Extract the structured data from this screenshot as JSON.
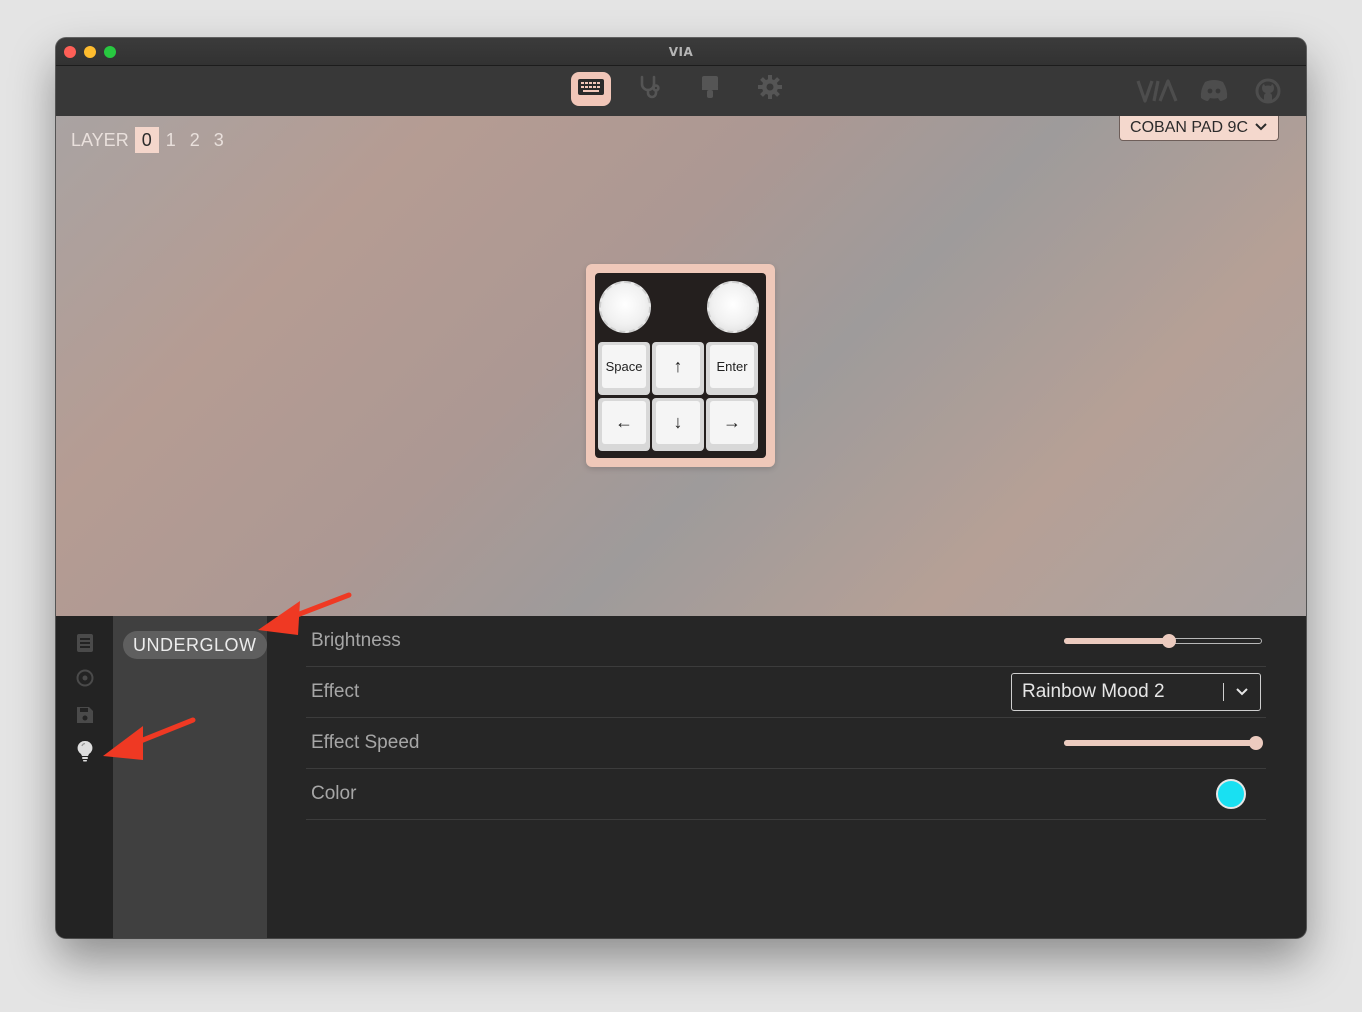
{
  "window": {
    "title": "VIA"
  },
  "toolbar": {
    "items": [
      {
        "name": "configure",
        "icon": "keyboard-icon",
        "active": true
      },
      {
        "name": "test",
        "icon": "stethoscope-icon",
        "active": false
      },
      {
        "name": "design",
        "icon": "paintbrush-icon",
        "active": false
      },
      {
        "name": "settings",
        "icon": "gear-icon",
        "active": false
      }
    ],
    "right_items": [
      "via-logo",
      "discord-icon",
      "github-icon"
    ]
  },
  "layers": {
    "label": "LAYER",
    "items": [
      "0",
      "1",
      "2",
      "3"
    ],
    "active_index": 0
  },
  "device": {
    "name": "COBAN PAD 9C"
  },
  "keyboard": {
    "knobs": 2,
    "keys": [
      "Space",
      "↑",
      "Enter",
      "←",
      "↓",
      "→"
    ]
  },
  "sidebar": {
    "icons": [
      "keymap-icon",
      "macro-icon",
      "save-icon",
      "lightbulb-icon"
    ],
    "active_icon": "lightbulb-icon"
  },
  "submenu": {
    "selected": "UNDERGLOW"
  },
  "settings": {
    "brightness": {
      "label": "Brightness",
      "level": 0.53
    },
    "effect": {
      "label": "Effect",
      "value": "Rainbow Mood 2"
    },
    "effect_speed": {
      "label": "Effect Speed",
      "level": 0.97
    },
    "color": {
      "label": "Color",
      "value": "#19e0f2"
    }
  },
  "colors": {
    "accent": "#f1c6b8",
    "annotation_arrow": "#ef3923"
  }
}
